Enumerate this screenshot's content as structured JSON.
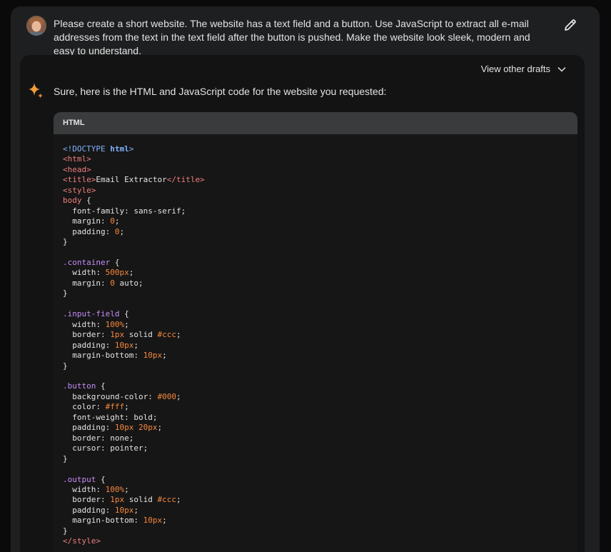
{
  "prompt": {
    "text": "Please create a short website. The website has a text field and a button. Use JavaScript to extract all e-mail addresses from the text in the text field after the button is pushed. Make the website look sleek, modern and easy to understand."
  },
  "response": {
    "view_drafts_label": "View other drafts",
    "intro": "Sure, here is the HTML and JavaScript code for the website you requested:",
    "code_language": "HTML",
    "code_lines": [
      [
        [
          "doctype",
          "<!DOCTYPE "
        ],
        [
          "strong",
          "html"
        ],
        [
          "doctype",
          ">"
        ]
      ],
      [
        [
          "tag",
          "<html>"
        ]
      ],
      [
        [
          "tag",
          "<head>"
        ]
      ],
      [
        [
          "tag",
          "<title>"
        ],
        [
          "punc",
          "Email Extractor"
        ],
        [
          "tag",
          "</title>"
        ]
      ],
      [
        [
          "tag",
          "<style>"
        ]
      ],
      [
        [
          "kw",
          "body"
        ],
        [
          "punc",
          " {"
        ]
      ],
      [
        [
          "punc",
          "  font-family: sans-serif;"
        ]
      ],
      [
        [
          "punc",
          "  margin: "
        ],
        [
          "num",
          "0"
        ],
        [
          "punc",
          ";"
        ]
      ],
      [
        [
          "punc",
          "  padding: "
        ],
        [
          "num",
          "0"
        ],
        [
          "punc",
          ";"
        ]
      ],
      [
        [
          "punc",
          "}"
        ]
      ],
      [
        [
          "punc",
          ""
        ]
      ],
      [
        [
          "sel",
          ".container"
        ],
        [
          "punc",
          " {"
        ]
      ],
      [
        [
          "punc",
          "  width: "
        ],
        [
          "num",
          "500px"
        ],
        [
          "punc",
          ";"
        ]
      ],
      [
        [
          "punc",
          "  margin: "
        ],
        [
          "num",
          "0"
        ],
        [
          "punc",
          " auto;"
        ]
      ],
      [
        [
          "punc",
          "}"
        ]
      ],
      [
        [
          "punc",
          ""
        ]
      ],
      [
        [
          "sel",
          ".input-field"
        ],
        [
          "punc",
          " {"
        ]
      ],
      [
        [
          "punc",
          "  width: "
        ],
        [
          "num",
          "100%"
        ],
        [
          "punc",
          ";"
        ]
      ],
      [
        [
          "punc",
          "  border: "
        ],
        [
          "num",
          "1px"
        ],
        [
          "punc",
          " solid "
        ],
        [
          "num",
          "#ccc"
        ],
        [
          "punc",
          ";"
        ]
      ],
      [
        [
          "punc",
          "  padding: "
        ],
        [
          "num",
          "10px"
        ],
        [
          "punc",
          ";"
        ]
      ],
      [
        [
          "punc",
          "  margin-bottom: "
        ],
        [
          "num",
          "10px"
        ],
        [
          "punc",
          ";"
        ]
      ],
      [
        [
          "punc",
          "}"
        ]
      ],
      [
        [
          "punc",
          ""
        ]
      ],
      [
        [
          "sel",
          ".button"
        ],
        [
          "punc",
          " {"
        ]
      ],
      [
        [
          "punc",
          "  background-color: "
        ],
        [
          "num",
          "#000"
        ],
        [
          "punc",
          ";"
        ]
      ],
      [
        [
          "punc",
          "  color: "
        ],
        [
          "num",
          "#fff"
        ],
        [
          "punc",
          ";"
        ]
      ],
      [
        [
          "punc",
          "  font-weight: bold;"
        ]
      ],
      [
        [
          "punc",
          "  padding: "
        ],
        [
          "num",
          "10px 20px"
        ],
        [
          "punc",
          ";"
        ]
      ],
      [
        [
          "punc",
          "  border: none;"
        ]
      ],
      [
        [
          "punc",
          "  cursor: pointer;"
        ]
      ],
      [
        [
          "punc",
          "}"
        ]
      ],
      [
        [
          "punc",
          ""
        ]
      ],
      [
        [
          "sel",
          ".output"
        ],
        [
          "punc",
          " {"
        ]
      ],
      [
        [
          "punc",
          "  width: "
        ],
        [
          "num",
          "100%"
        ],
        [
          "punc",
          ";"
        ]
      ],
      [
        [
          "punc",
          "  border: "
        ],
        [
          "num",
          "1px"
        ],
        [
          "punc",
          " solid "
        ],
        [
          "num",
          "#ccc"
        ],
        [
          "punc",
          ";"
        ]
      ],
      [
        [
          "punc",
          "  padding: "
        ],
        [
          "num",
          "10px"
        ],
        [
          "punc",
          ";"
        ]
      ],
      [
        [
          "punc",
          "  margin-bottom: "
        ],
        [
          "num",
          "10px"
        ],
        [
          "punc",
          ";"
        ]
      ],
      [
        [
          "punc",
          "}"
        ]
      ],
      [
        [
          "tag",
          "</style>"
        ]
      ]
    ]
  },
  "icons": {
    "edit": "pencil-icon",
    "expand": "chevron-down-icon",
    "assistant": "sparkle-icon"
  },
  "colors": {
    "accent_sparkle": "#f29b38",
    "syntax_tag": "#ef7d7d",
    "syntax_selector": "#c48cf5",
    "syntax_number": "#f6873d",
    "syntax_keyword_html": "#80b1ff"
  }
}
